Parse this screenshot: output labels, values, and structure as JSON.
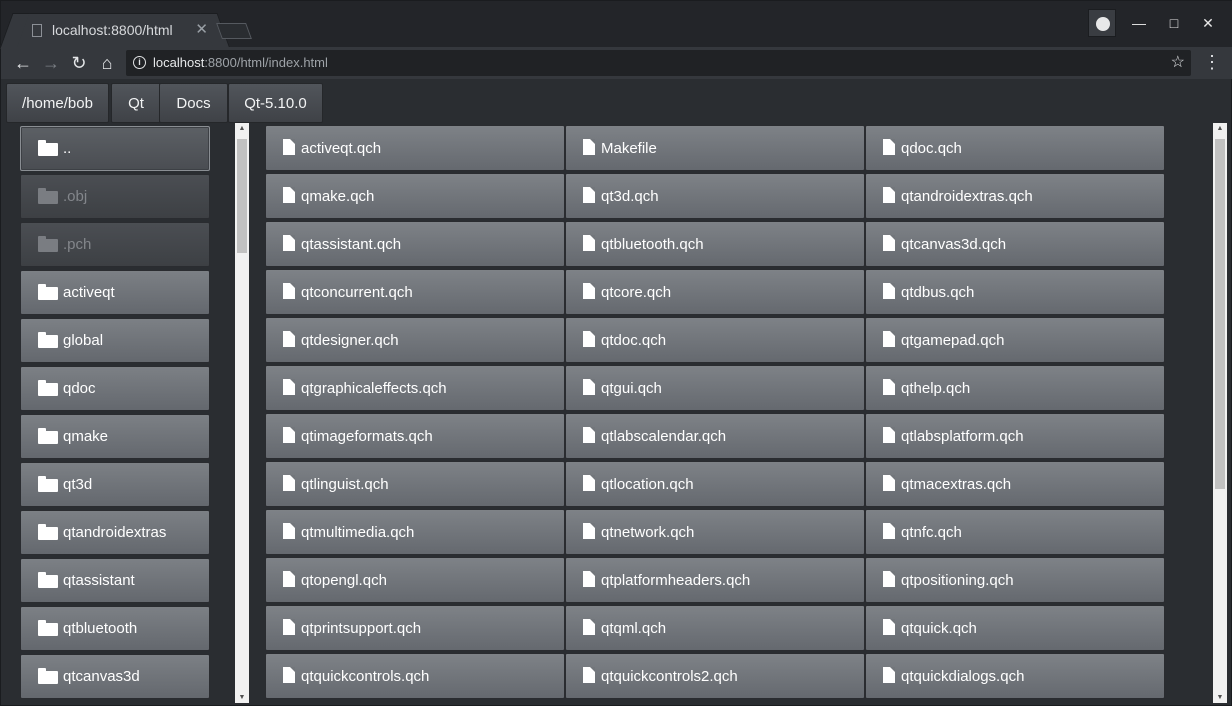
{
  "tab": {
    "title": "localhost:8800/html",
    "close": "✕"
  },
  "window_controls": {
    "minimize": "—",
    "maximize": "□",
    "close": "✕"
  },
  "toolbar": {
    "back": "←",
    "forward": "→",
    "reload": "↻",
    "home": "⌂",
    "url_host": "localhost",
    "url_path": ":8800/html/index.html",
    "info": "i",
    "bookmark": "☆",
    "menu": "⋮"
  },
  "breadcrumbs": [
    "/home/bob",
    "Qt",
    "Docs",
    "Qt-5.10.0"
  ],
  "directories": [
    {
      "label": "..",
      "state": "selected"
    },
    {
      "label": ".obj",
      "state": "dim"
    },
    {
      "label": ".pch",
      "state": "dim"
    },
    {
      "label": "activeqt",
      "state": "normal"
    },
    {
      "label": "global",
      "state": "normal"
    },
    {
      "label": "qdoc",
      "state": "normal"
    },
    {
      "label": "qmake",
      "state": "normal"
    },
    {
      "label": "qt3d",
      "state": "normal"
    },
    {
      "label": "qtandroidextras",
      "state": "normal"
    },
    {
      "label": "qtassistant",
      "state": "normal"
    },
    {
      "label": "qtbluetooth",
      "state": "normal"
    },
    {
      "label": "qtcanvas3d",
      "state": "normal"
    }
  ],
  "files": [
    "activeqt.qch",
    "Makefile",
    "qdoc.qch",
    "qmake.qch",
    "qt3d.qch",
    "qtandroidextras.qch",
    "qtassistant.qch",
    "qtbluetooth.qch",
    "qtcanvas3d.qch",
    "qtconcurrent.qch",
    "qtcore.qch",
    "qtdbus.qch",
    "qtdesigner.qch",
    "qtdoc.qch",
    "qtgamepad.qch",
    "qtgraphicaleffects.qch",
    "qtgui.qch",
    "qthelp.qch",
    "qtimageformats.qch",
    "qtlabscalendar.qch",
    "qtlabsplatform.qch",
    "qtlinguist.qch",
    "qtlocation.qch",
    "qtmacextras.qch",
    "qtmultimedia.qch",
    "qtnetwork.qch",
    "qtnfc.qch",
    "qtopengl.qch",
    "qtplatformheaders.qch",
    "qtpositioning.qch",
    "qtprintsupport.qch",
    "qtqml.qch",
    "qtquick.qch",
    "qtquickcontrols.qch",
    "qtquickcontrols2.qch",
    "qtquickdialogs.qch"
  ],
  "scroll": {
    "up": "▲",
    "down": "▼"
  }
}
